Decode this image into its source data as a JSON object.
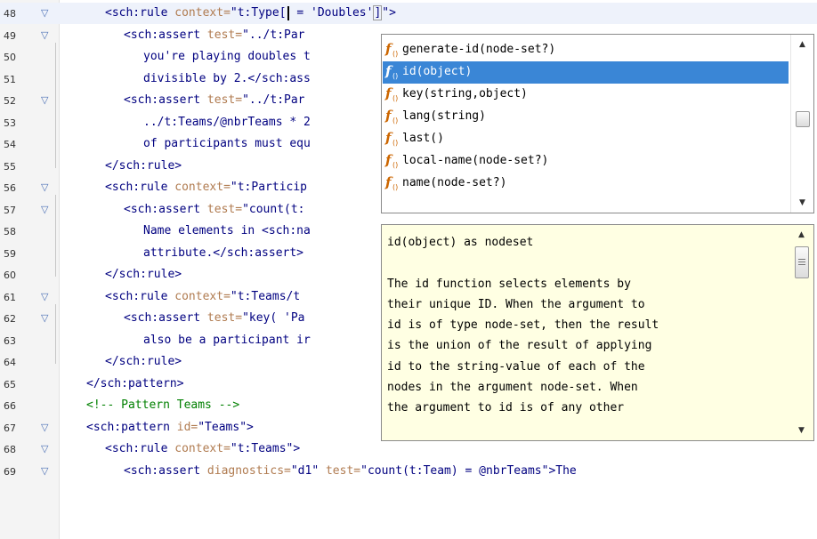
{
  "editor": {
    "lines": [
      {
        "num": "48",
        "fold": "▽",
        "current": true,
        "parts": [
          [
            "t",
            "<sch:rule "
          ],
          [
            "a",
            "context="
          ],
          [
            "v",
            "\"t:Type["
          ],
          [
            "caret",
            ""
          ],
          [
            "v",
            " = 'Doubles'"
          ],
          [
            "box",
            "]"
          ],
          [
            "v",
            "\""
          ],
          [
            "t",
            ">"
          ]
        ]
      },
      {
        "num": "49",
        "fold": "▽",
        "parts": [
          [
            "t",
            "<sch:assert "
          ],
          [
            "a",
            "test="
          ],
          [
            "v",
            "\"../t:Par"
          ]
        ]
      },
      {
        "num": "50",
        "fold": "",
        "parts": [
          [
            "t",
            "you're playing doubles t"
          ]
        ]
      },
      {
        "num": "51",
        "fold": "",
        "parts": [
          [
            "t",
            "divisible by 2.</sch:ass"
          ]
        ]
      },
      {
        "num": "52",
        "fold": "▽",
        "parts": [
          [
            "t",
            "<sch:assert "
          ],
          [
            "a",
            "test="
          ],
          [
            "v",
            "\"../t:Par"
          ]
        ]
      },
      {
        "num": "53",
        "fold": "",
        "parts": [
          [
            "t",
            "../t:Teams/@nbrTeams * 2"
          ]
        ]
      },
      {
        "num": "54",
        "fold": "",
        "parts": [
          [
            "t",
            "of participants must equ"
          ]
        ]
      },
      {
        "num": "55",
        "fold": "",
        "parts": [
          [
            "t",
            "</sch:rule>"
          ]
        ]
      },
      {
        "num": "56",
        "fold": "▽",
        "parts": [
          [
            "t",
            "<sch:rule "
          ],
          [
            "a",
            "context="
          ],
          [
            "v",
            "\"t:Particip"
          ]
        ]
      },
      {
        "num": "57",
        "fold": "▽",
        "parts": [
          [
            "t",
            "<sch:assert "
          ],
          [
            "a",
            "test="
          ],
          [
            "v",
            "\"count(t:"
          ]
        ]
      },
      {
        "num": "58",
        "fold": "",
        "parts": [
          [
            "t",
            "Name elements in <sch:na"
          ]
        ]
      },
      {
        "num": "59",
        "fold": "",
        "parts": [
          [
            "t",
            "attribute.</sch:assert>"
          ]
        ]
      },
      {
        "num": "60",
        "fold": "",
        "parts": [
          [
            "t",
            "</sch:rule>"
          ]
        ]
      },
      {
        "num": "61",
        "fold": "▽",
        "parts": [
          [
            "t",
            "<sch:rule "
          ],
          [
            "a",
            "context="
          ],
          [
            "v",
            "\"t:Teams/t"
          ]
        ]
      },
      {
        "num": "62",
        "fold": "▽",
        "parts": [
          [
            "t",
            "<sch:assert "
          ],
          [
            "a",
            "test="
          ],
          [
            "v",
            "\"key( 'Pa"
          ]
        ]
      },
      {
        "num": "63",
        "fold": "",
        "parts": [
          [
            "t",
            "also be a participant ir"
          ]
        ]
      },
      {
        "num": "64",
        "fold": "",
        "parts": [
          [
            "t",
            "</sch:rule>"
          ]
        ]
      },
      {
        "num": "65",
        "fold": "",
        "parts": [
          [
            "t",
            "</sch:pattern>"
          ]
        ]
      },
      {
        "num": "66",
        "fold": "",
        "parts": [
          [
            "c",
            "<!-- Pattern Teams -->"
          ]
        ]
      },
      {
        "num": "67",
        "fold": "▽",
        "parts": [
          [
            "t",
            "<sch:pattern "
          ],
          [
            "a",
            "id="
          ],
          [
            "v",
            "\"Teams\""
          ],
          [
            "t",
            ">"
          ]
        ]
      },
      {
        "num": "68",
        "fold": "▽",
        "parts": [
          [
            "t",
            "<sch:rule "
          ],
          [
            "a",
            "context="
          ],
          [
            "v",
            "\"t:Teams\""
          ],
          [
            "t",
            ">"
          ]
        ]
      },
      {
        "num": "69",
        "fold": "▽",
        "parts": [
          [
            "t",
            "<sch:assert "
          ],
          [
            "a",
            "diagnostics="
          ],
          [
            "v",
            "\"d1\""
          ],
          [
            "a",
            " test="
          ],
          [
            "v",
            "\"count(t:Team) = @nbrTeams\""
          ],
          [
            "t",
            ">The"
          ]
        ]
      }
    ]
  },
  "completion": {
    "items": [
      {
        "label": "generate-id(node-set?)",
        "icon": "function-icon",
        "selected": false
      },
      {
        "label": "id(object)",
        "icon": "function-icon",
        "selected": true
      },
      {
        "label": "key(string,object)",
        "icon": "function-icon",
        "selected": false
      },
      {
        "label": "lang(string)",
        "icon": "function-icon",
        "selected": false
      },
      {
        "label": "last()",
        "icon": "function-icon",
        "selected": false
      },
      {
        "label": "local-name(node-set?)",
        "icon": "function-icon",
        "selected": false
      },
      {
        "label": "name(node-set?)",
        "icon": "function-icon",
        "selected": false
      }
    ],
    "scroll_up_icon": "▲",
    "scroll_down_icon": "▼"
  },
  "documentation": {
    "lines": [
      "id(object) as nodeset",
      "",
      "The id function selects elements by",
      "their unique ID. When the argument to",
      "id is of type node-set, then the result",
      "is the union of the result of applying",
      "id to the string-value of each of the",
      "nodes in the argument node-set. When",
      "the argument to id is of any other"
    ],
    "scroll_up_icon": "▲",
    "scroll_down_icon": "▼"
  },
  "colors": {
    "tag": "#000080",
    "attribute": "#b07b50",
    "comment": "#008000",
    "selection": "#3a86d6",
    "doc_background": "#ffffe3",
    "function_icon": "#cc6600"
  }
}
